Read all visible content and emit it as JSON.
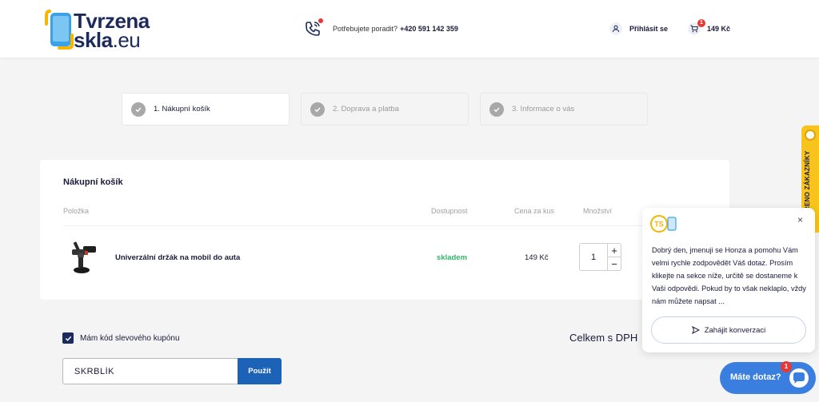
{
  "header": {
    "logo": {
      "line1": "Tvrzena",
      "line2": "skla",
      "domain": ".eu"
    },
    "phone": {
      "label": "Potřebujete poradit?",
      "number": "+420 591 142 359"
    },
    "login_label": "Přihlásit se",
    "cart": {
      "count": "1",
      "total": "149 Kč"
    }
  },
  "steps": [
    {
      "label": "1. Nákupní košík"
    },
    {
      "label": "2. Doprava a platba"
    },
    {
      "label": "3. Informace o vás"
    }
  ],
  "cart_section": {
    "title": "Nákupní košík",
    "columns": {
      "item": "Položka",
      "availability": "Dostupnost",
      "unit_price": "Cena za kus",
      "quantity": "Množství"
    },
    "items": [
      {
        "name": "Univerzální držák na mobil do auta",
        "availability": "skladem",
        "price": "149 Kč",
        "quantity": "1"
      }
    ]
  },
  "coupon": {
    "checkbox_label": "Mám kód slevového kupónu",
    "value": "SKRBLÍK",
    "button_label": "Použít"
  },
  "total_label": "Celkem s DPH",
  "verified_badge": "OVĚŘENO ZÁKAZNÍKY",
  "chat": {
    "avatar_text": "TS",
    "close": "×",
    "message": "Dobrý den, jmenuji se Honza a pomohu Vám velmi rychle zodpovědět Váš dotaz. Prosím klikejte na sekce níže, určitě se dostaneme k Vaši odpovědi. Pokud by to však neklaplo, vždy nám můžete napsat ...",
    "start_button": "Zahájit konverzaci",
    "launcher_label": "Máte dotaz?",
    "launcher_badge": "1"
  },
  "colors": {
    "brand_navy": "#1d2a5c",
    "accent_blue": "#1c63b8",
    "stock_green": "#2fb66a",
    "badge_red": "#e53935",
    "chat_blue": "#3a7fe0",
    "verified_yellow": "#f7c31c"
  }
}
